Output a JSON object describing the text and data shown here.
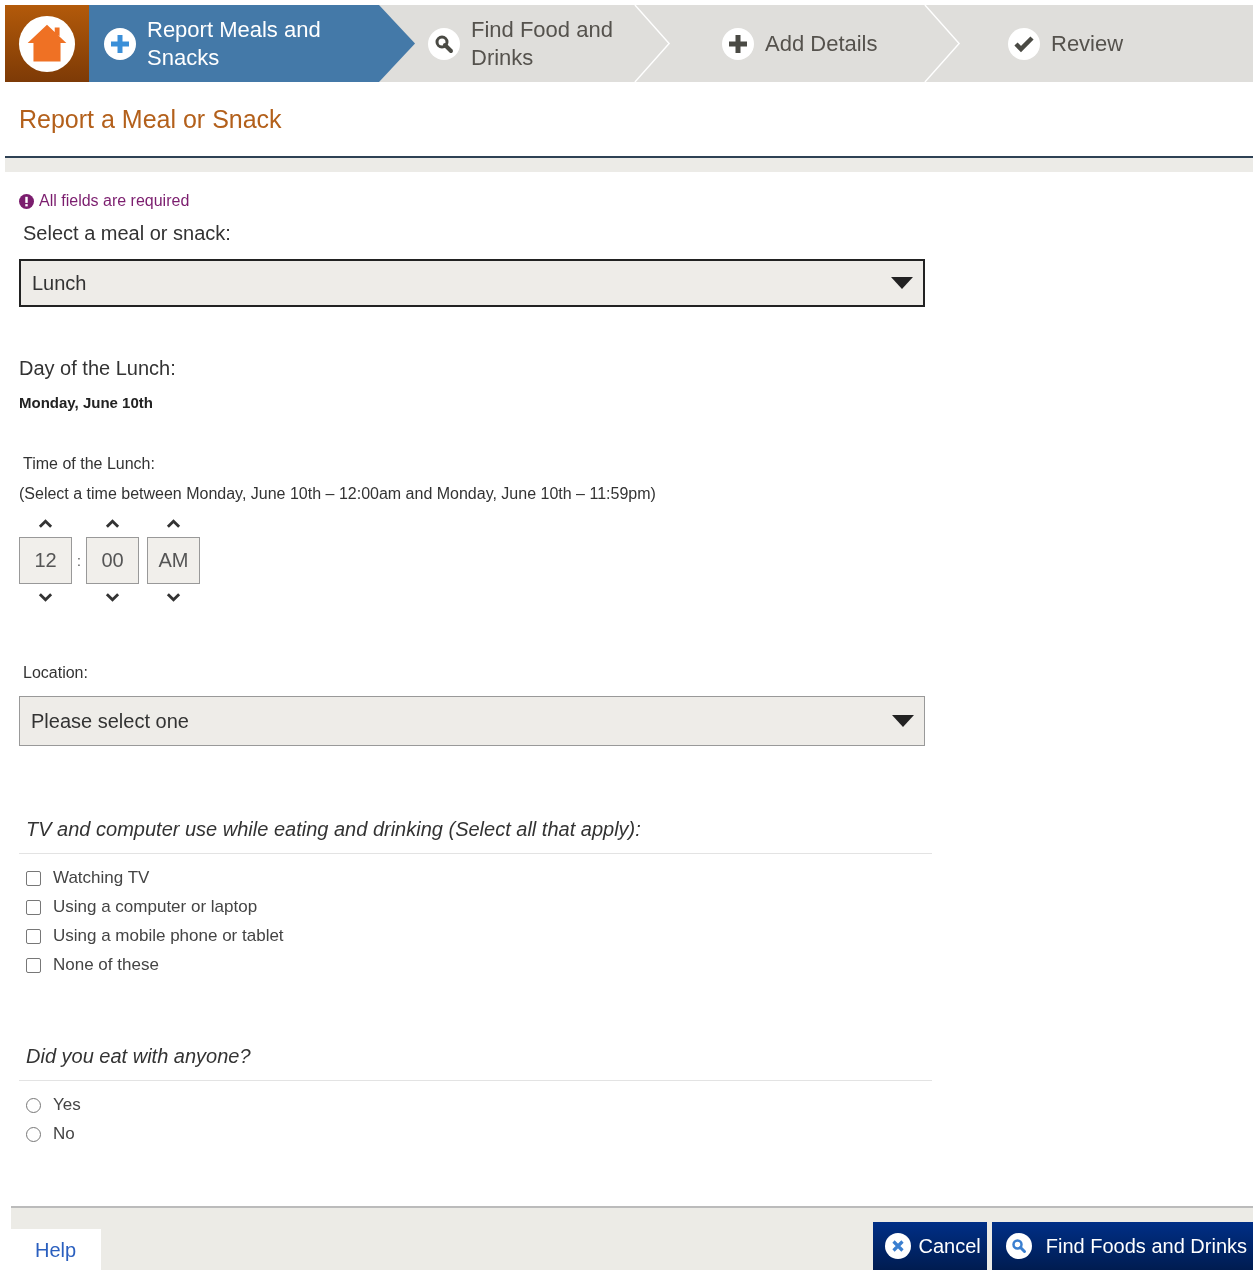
{
  "steps": [
    {
      "label": "Report Meals and Snacks",
      "kind": "plus",
      "selected": true
    },
    {
      "label": "Find Food and Drinks",
      "kind": "search",
      "selected": false
    },
    {
      "label": "Add Details",
      "kind": "plus",
      "selected": false
    },
    {
      "label": "Review",
      "kind": "check",
      "selected": false
    }
  ],
  "page_title": "Report a Meal or Snack",
  "required_note": "All fields are required",
  "meal": {
    "label": "Select a meal or snack:",
    "value": "Lunch"
  },
  "day": {
    "label": "Day of the Lunch:",
    "value": "Monday, June 10th"
  },
  "time": {
    "label": "Time of the Lunch:",
    "hint": "(Select a time between Monday, June 10th – 12:00am and Monday, June 10th – 11:59pm)",
    "hour": "12",
    "separator": ":",
    "minute": "00",
    "period": "AM"
  },
  "location": {
    "label": "Location:",
    "value": "Please select one"
  },
  "screen_use": {
    "question": "TV and computer use while eating and drinking (Select all that apply):",
    "options": [
      {
        "label": "Watching TV",
        "checked": false
      },
      {
        "label": "Using a computer or laptop",
        "checked": false
      },
      {
        "label": "Using a mobile phone or tablet",
        "checked": false
      },
      {
        "label": "None of these",
        "checked": false
      }
    ]
  },
  "company": {
    "question": "Did you eat with anyone?",
    "options": [
      {
        "label": "Yes",
        "selected": false
      },
      {
        "label": "No",
        "selected": false
      }
    ]
  },
  "footer": {
    "help": "Help",
    "buttons": [
      {
        "label": "Cancel",
        "kind": "cancel"
      },
      {
        "label": "Find Foods and Drinks",
        "kind": "search"
      }
    ]
  }
}
